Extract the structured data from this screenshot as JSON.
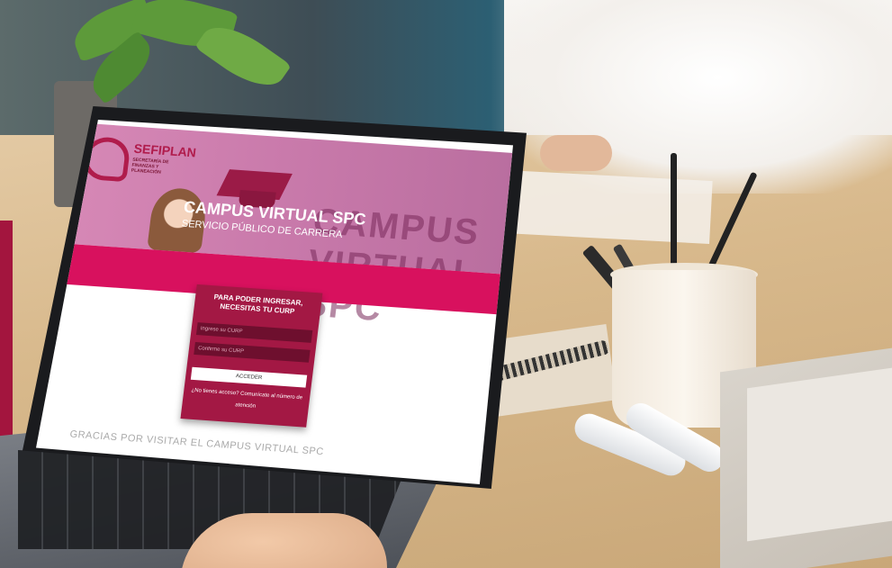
{
  "logo": {
    "name": "SEFIPLAN",
    "subtitle": "SECRETARÍA DE FINANZAS Y PLANEACIÓN"
  },
  "hero": {
    "title": "CAMPUS VIRTUAL SPC",
    "subtitle": "SERVICIO PÚBLICO DE CARRERA",
    "background_text": "CAMPUS VIRTUAL SPC"
  },
  "login": {
    "heading": "PARA PODER INGRESAR, NECESITAS TU CURP",
    "curp_placeholder": "Ingrese su CURP",
    "confirm_placeholder": "Confirme su CURP",
    "submit_label": "ACCEDER",
    "help_text": "¿No tienes acceso? Comunícate al número de atención"
  },
  "footer": {
    "thanks": "GRACIAS POR VISITAR EL CAMPUS VIRTUAL SPC"
  },
  "colors": {
    "brand": "#b01c4c",
    "band": "#d8115e",
    "card": "#a31844",
    "hero": "#c97aab"
  }
}
